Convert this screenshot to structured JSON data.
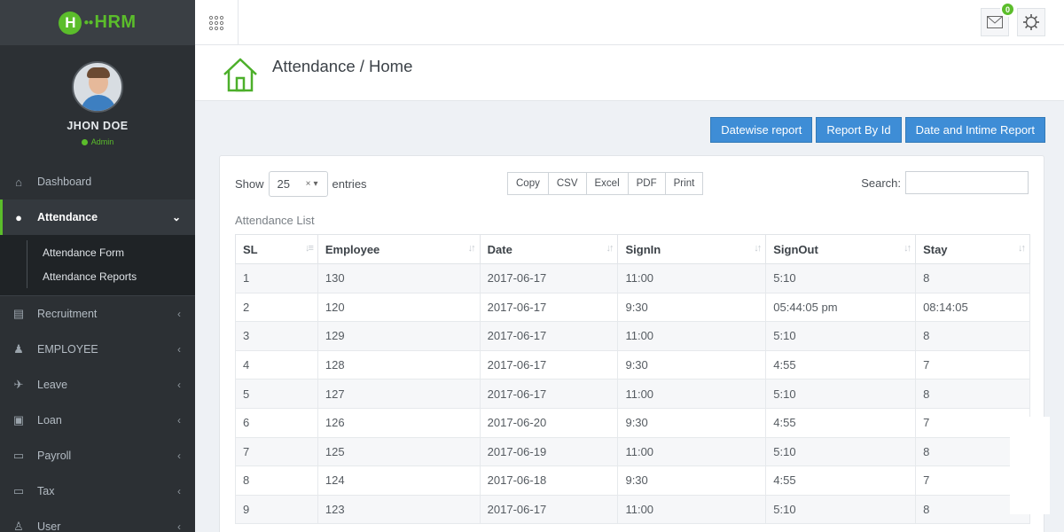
{
  "brand": {
    "logo_letter": "H",
    "logo_text": "HRM"
  },
  "profile": {
    "name": "JHON DOE",
    "role": "Admin"
  },
  "menu": {
    "dashboard": "Dashboard",
    "attendance": "Attendance",
    "attendance_sub": [
      "Attendance Form",
      "Attendance Reports"
    ],
    "recruitment": "Recruitment",
    "employee": "EMPLOYEE",
    "leave": "Leave",
    "loan": "Loan",
    "payroll": "Payroll",
    "tax": "Tax",
    "user": "User"
  },
  "topbar": {
    "mail_badge": "0"
  },
  "page": {
    "title": "Attendance / Home"
  },
  "report_buttons": [
    "Datewise report",
    "Report By Id",
    "Date and Intime Report"
  ],
  "controls": {
    "show_label": "Show",
    "entries_value": "25",
    "entries_label": "entries",
    "export_buttons": [
      "Copy",
      "CSV",
      "Excel",
      "PDF",
      "Print"
    ],
    "search_label": "Search:",
    "list_title": "Attendance List"
  },
  "table": {
    "columns": [
      "SL",
      "Employee",
      "Date",
      "SignIn",
      "SignOut",
      "Stay"
    ],
    "rows": [
      [
        "1",
        "130",
        "2017-06-17",
        "11:00",
        "5:10",
        "8"
      ],
      [
        "2",
        "120",
        "2017-06-17",
        "9:30",
        "05:44:05 pm",
        "08:14:05"
      ],
      [
        "3",
        "129",
        "2017-06-17",
        "11:00",
        "5:10",
        "8"
      ],
      [
        "4",
        "128",
        "2017-06-17",
        "9:30",
        "4:55",
        "7"
      ],
      [
        "5",
        "127",
        "2017-06-17",
        "11:00",
        "5:10",
        "8"
      ],
      [
        "6",
        "126",
        "2017-06-20",
        "9:30",
        "4:55",
        "7"
      ],
      [
        "7",
        "125",
        "2017-06-19",
        "11:00",
        "5:10",
        "8"
      ],
      [
        "8",
        "124",
        "2017-06-18",
        "9:30",
        "4:55",
        "7"
      ],
      [
        "9",
        "123",
        "2017-06-17",
        "11:00",
        "5:10",
        "8"
      ]
    ]
  },
  "colors": {
    "accent_green": "#5bbd2b",
    "button_blue": "#3e8dd6",
    "sidebar_bg": "#2c3034"
  }
}
